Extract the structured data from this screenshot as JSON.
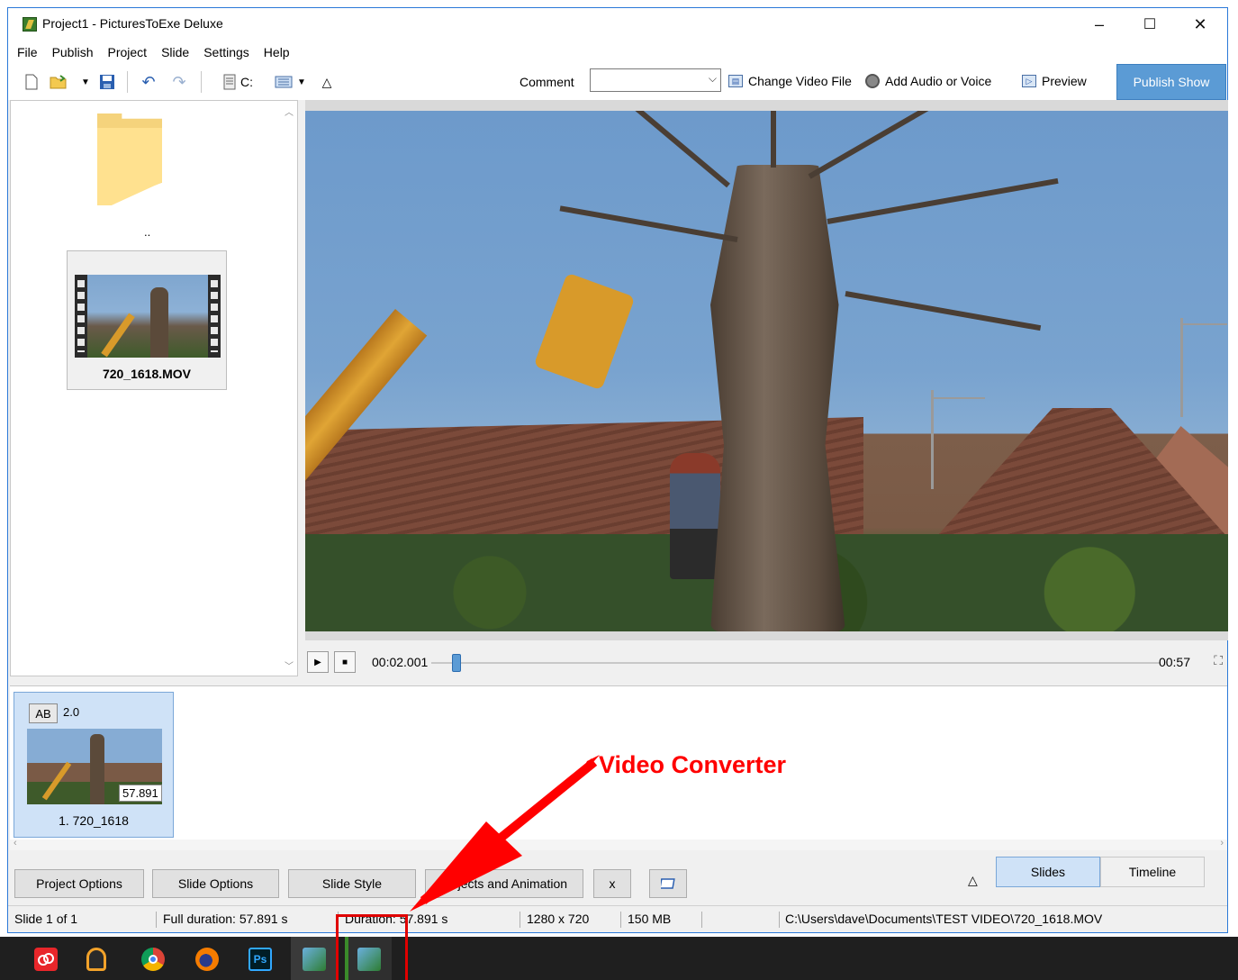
{
  "window": {
    "title": "Project1 - PicturesToExe Deluxe",
    "controls": {
      "minimize": "–",
      "maximize": "☐",
      "close": "✕"
    }
  },
  "menu": [
    "File",
    "Publish",
    "Project",
    "Slide",
    "Settings",
    "Help"
  ],
  "toolbar": {
    "drive_label": "C:",
    "comment_label": "Comment",
    "comment_value": "",
    "change_video_label": "Change Video File",
    "add_audio_label": "Add Audio or Voice",
    "preview_label": "Preview",
    "publish_label": "Publish Show",
    "up_arrow": "△"
  },
  "file_browser": {
    "parent_label": "..",
    "file_name": "720_1618.MOV"
  },
  "player": {
    "current_time": "00:02.001",
    "total_time": "00:57",
    "progress": 0.035
  },
  "slide_strip": {
    "slides": [
      {
        "transition_badge": "AB",
        "transition_duration": "2.0",
        "duration": "57.891",
        "label": "1. 720_1618"
      }
    ]
  },
  "bottom_buttons": {
    "project_options": "Project Options",
    "slide_options": "Slide Options",
    "slide_style": "Slide Style",
    "objects_animation": "Objects and Animation",
    "x_button": "x",
    "up_arrow": "△",
    "tab_slides": "Slides",
    "tab_timeline": "Timeline"
  },
  "status": {
    "slide_count": "Slide 1 of 1",
    "full_duration": "Full duration: 57.891 s",
    "duration": "Duration: 57.891 s",
    "resolution": "1280 x 720",
    "size": "150 MB",
    "path": "C:\\Users\\dave\\Documents\\TEST VIDEO\\720_1618.MOV"
  },
  "annotation": {
    "text": "Video Converter",
    "color": "#ff0000"
  },
  "taskbar": {
    "apps": [
      "creative-cloud-icon",
      "headphones-icon",
      "chrome-icon",
      "firefox-icon",
      "photoshop-icon",
      "pte-icon",
      "video-converter-icon"
    ],
    "photoshop_label": "Ps"
  },
  "colors": {
    "accent": "#5b9bd5",
    "selection": "#cfe2f7",
    "annotation": "#ff0000"
  }
}
